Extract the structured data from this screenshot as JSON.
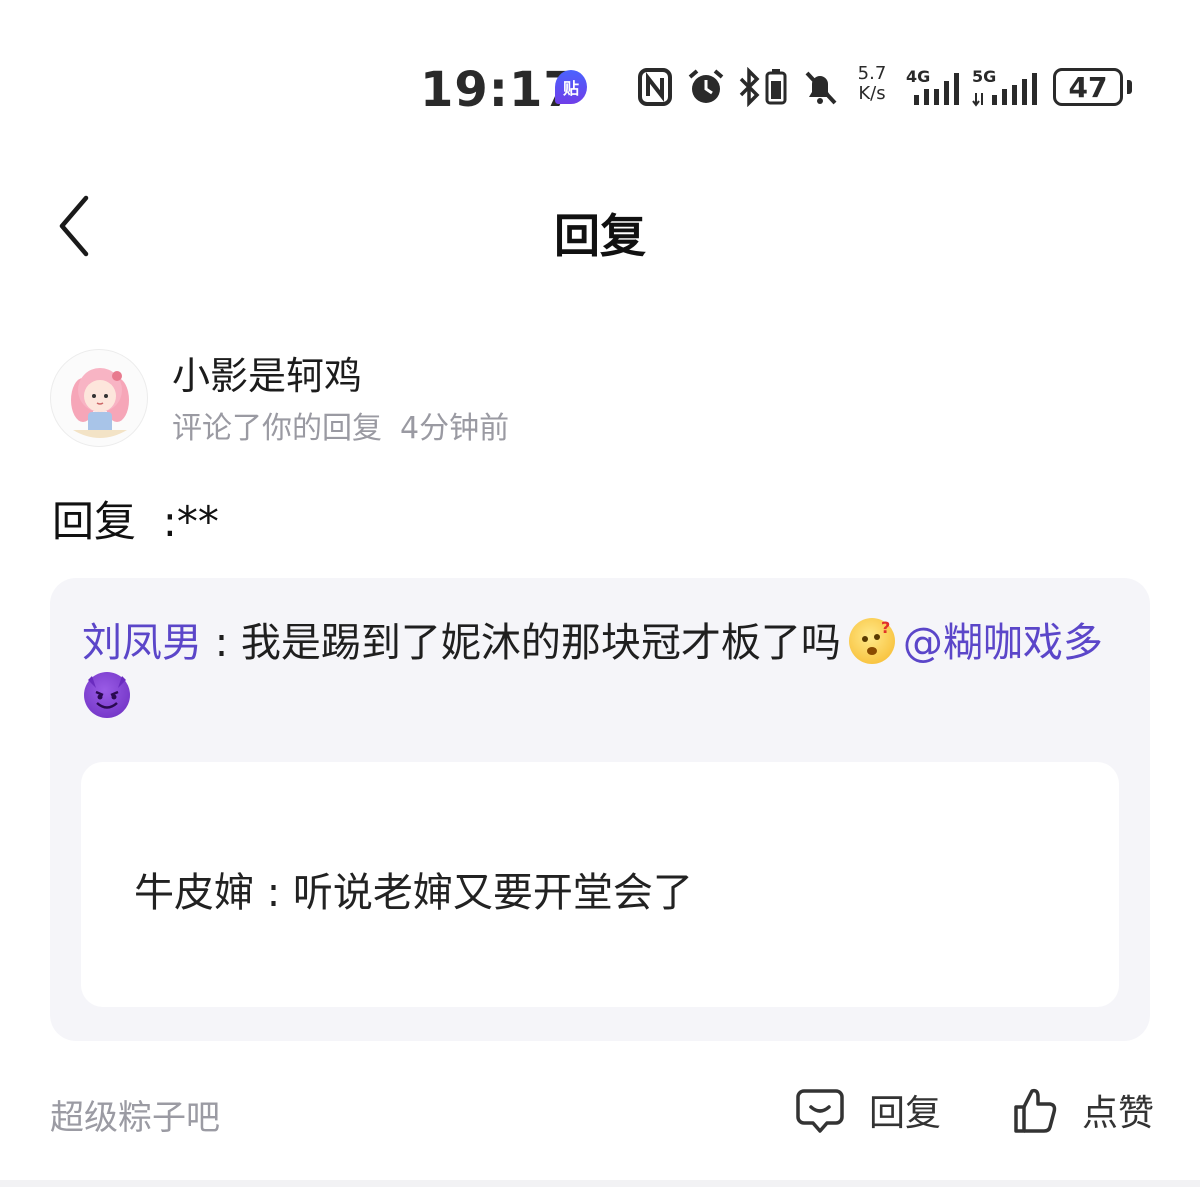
{
  "status_bar": {
    "time": "19:17",
    "app_badge": "贴",
    "net_speed_value": "5.7",
    "net_speed_unit": "K/s",
    "sim1_label": "4G",
    "sim2_label": "5G",
    "battery": "47"
  },
  "header": {
    "title": "回复"
  },
  "comment": {
    "username": "小影是轲鸡",
    "action": "评论了你的回复",
    "time": "4分钟前",
    "reply_text": "回复  :**"
  },
  "quote": {
    "author": "刘凤男",
    "separator": " : ",
    "text": "我是踢到了妮沐的那块冠才板了吗",
    "mention": "@糊咖戏多",
    "inner_author": "牛皮婶",
    "inner_separator": " : ",
    "inner_text": "听说老婶又要开堂会了"
  },
  "footer": {
    "forum": "超级粽子吧",
    "reply_label": "回复",
    "like_label": "点赞"
  },
  "colors": {
    "accent_purple": "#5b46c9",
    "card_bg": "#f5f5f9",
    "meta_gray": "#9a9aa2"
  }
}
